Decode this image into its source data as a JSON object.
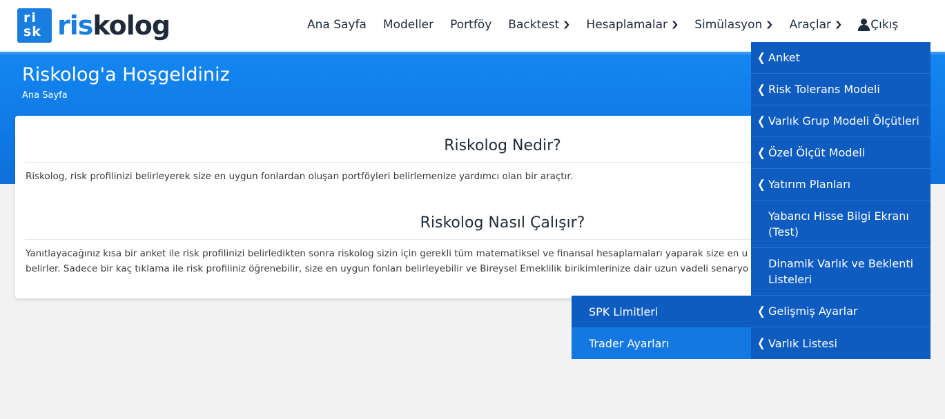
{
  "brand": {
    "logo_mark_top": "ri",
    "logo_mark_bottom": "sk",
    "name_part1": "ris",
    "name_part2": "kolog"
  },
  "nav": {
    "items": [
      {
        "label": "Ana Sayfa",
        "dropdown": false
      },
      {
        "label": "Modeller",
        "dropdown": false
      },
      {
        "label": "Portföy",
        "dropdown": false
      },
      {
        "label": "Backtest",
        "dropdown": true
      },
      {
        "label": "Hesaplamalar",
        "dropdown": true
      },
      {
        "label": "Simülasyon",
        "dropdown": true
      },
      {
        "label": "Araçlar",
        "dropdown": true
      }
    ],
    "logout_label": "Çıkış"
  },
  "hero": {
    "title": "Riskolog'a Hoşgeldiniz",
    "breadcrumb": "Ana Sayfa"
  },
  "content": {
    "section1_title": "Riskolog Nedir?",
    "section1_text": "Riskolog, risk profilinizi belirleyerek size en uygun fonlardan oluşan portföyleri belirlemenize yardımcı olan bir araçtır.",
    "section2_title": "Riskolog Nasıl Çalışır?",
    "section2_text_line1": "Yanıtlayacağınız kısa bir anket ile risk profilinizi belirledikten sonra riskolog sizin için gerekli tüm matematiksel ve finansal hesaplamaları yaparak size en u",
    "section2_text_line2": "belirler. Sadece bir kaç tıklama ile risk profiliniz öğrenebilir, size en uygun fonları belirleyebilir ve Bireysel Emeklilik birikimlerinize dair uzun vadeli senaryo"
  },
  "araclar_menu": {
    "items": [
      {
        "label": "Anket",
        "has_submenu": true
      },
      {
        "label": "Risk Tolerans Modeli",
        "has_submenu": true
      },
      {
        "label": "Varlık Grup Modeli Ölçütleri",
        "has_submenu": true
      },
      {
        "label": "Özel Ölçüt Modeli",
        "has_submenu": true
      },
      {
        "label": "Yatırım Planları",
        "has_submenu": true
      },
      {
        "label": "Yabancı Hisse Bilgi Ekranı (Test)",
        "has_submenu": false
      },
      {
        "label": "Dinamik Varlık ve Beklenti Listeleri",
        "has_submenu": false
      },
      {
        "label": "Gelişmiş Ayarlar",
        "has_submenu": true
      },
      {
        "label": "Varlık Listesi",
        "has_submenu": true
      }
    ],
    "submenu": {
      "parent": "Gelişmiş Ayarlar",
      "items": [
        {
          "label": "SPK Limitleri"
        },
        {
          "label": "Trader Ayarları"
        }
      ]
    }
  },
  "colors": {
    "primary": "#1a7ee0",
    "hero": "#1079e6",
    "menu": "#0f5cc0",
    "submenu_active": "#1378e2"
  }
}
